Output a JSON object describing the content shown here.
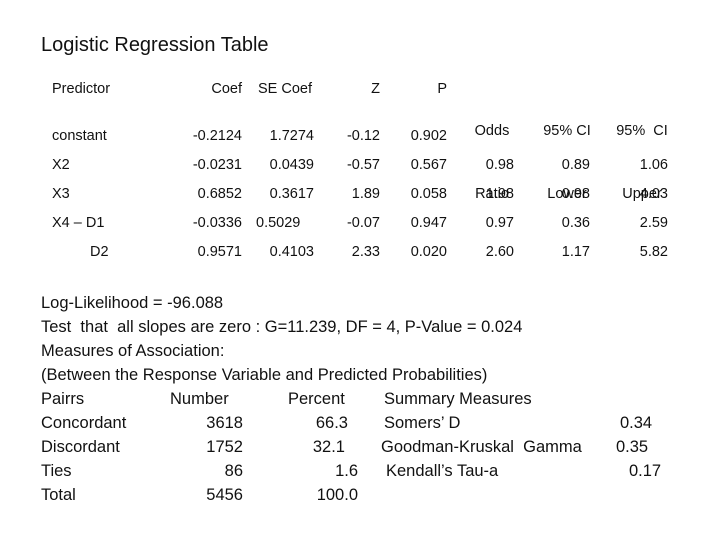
{
  "title": "Logistic Regression Table",
  "headers": {
    "predictor": "Predictor",
    "coef": "Coef",
    "se_coef": "SE Coef",
    "z": "Z",
    "p": "P",
    "odds_ratio": [
      "Odds",
      "Ratio"
    ],
    "ci_lower": [
      "95% CI",
      "Lower"
    ],
    "ci_upper": [
      "95%  CI",
      "Upper"
    ]
  },
  "rows": [
    {
      "predictor": "constant",
      "coef": "-0.2124",
      "se_coef": "1.7274",
      "z": "-0.12",
      "p": "0.902",
      "odds_ratio": "",
      "ci_lower": "",
      "ci_upper": ""
    },
    {
      "predictor": "X2",
      "coef": "-0.0231",
      "se_coef": "0.0439",
      "z": "-0.57",
      "p": "0.567",
      "odds_ratio": "0.98",
      "ci_lower": "0.89",
      "ci_upper": "1.06"
    },
    {
      "predictor": "X3",
      "coef": "0.6852",
      "se_coef": "0.3617",
      "z": "1.89",
      "p": "0.058",
      "odds_ratio": "1.98",
      "ci_lower": "0.98",
      "ci_upper": "4.03"
    },
    {
      "predictor": "X4 – D1",
      "coef": "-0.0336",
      "se_coef": "0.5029",
      "z": "-0.07",
      "p": "0.947",
      "odds_ratio": "0.97",
      "ci_lower": "0.36",
      "ci_upper": "2.59"
    },
    {
      "predictor": "D2",
      "coef": "0.9571",
      "se_coef": "0.4103",
      "z": "2.33",
      "p": "0.020",
      "odds_ratio": "2.60",
      "ci_lower": "1.17",
      "ci_upper": "5.82"
    }
  ],
  "stats": {
    "log_likelihood": "Log-Likelihood = -96.088",
    "slopes_test": "Test  that  all slopes are zero : G=11.239, DF = 4, P-Value = 0.024",
    "measures_heading": "Measures of Association:",
    "measures_subheading": "(Between the Response Variable and Predicted Probabilities)"
  },
  "association": {
    "headers": {
      "pairs": "Pairrs",
      "number": "Number",
      "percent": "Percent",
      "summary": "Summary Measures"
    },
    "rows": [
      {
        "pairs": "Concordant",
        "number": "3618",
        "percent": "66.3",
        "measure": "Somers’ D",
        "value": "0.34"
      },
      {
        "pairs": "Discordant",
        "number": "1752",
        "percent": "32.1",
        "measure": "Goodman-Kruskal  Gamma",
        "value": "0.35"
      },
      {
        "pairs": "Ties",
        "number": "86",
        "percent": "1.6",
        "measure": "Kendall’s Tau-a",
        "value": "0.17"
      },
      {
        "pairs": "Total",
        "number": "5456",
        "percent": "100.0",
        "measure": "",
        "value": ""
      }
    ]
  }
}
